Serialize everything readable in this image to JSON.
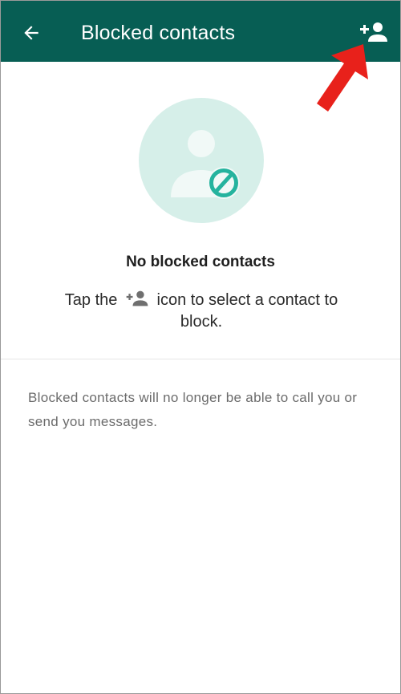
{
  "app_bar": {
    "title": "Blocked contacts",
    "back_icon": "arrow-left-icon",
    "action_icon": "add-contact-icon",
    "color": "#075e54"
  },
  "empty_state": {
    "heading": "No blocked contacts",
    "hint_before": "Tap the",
    "hint_icon": "add-contact-icon",
    "hint_after": "icon to select a contact to block.",
    "illustration": "blocked-person-icon",
    "accent_color": "#25b39e"
  },
  "info": {
    "text": "Blocked contacts will no longer be able to call you or send you messages."
  },
  "annotation": {
    "icon": "red-arrow-icon",
    "color": "#e8211b"
  }
}
